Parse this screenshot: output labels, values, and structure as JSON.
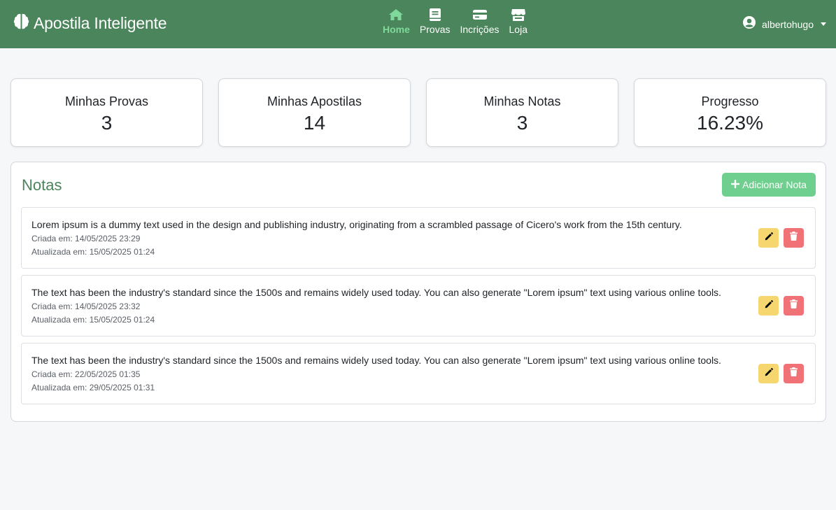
{
  "navbar": {
    "brand": "Apostila Inteligente",
    "items": [
      {
        "label": "Home",
        "icon": "home-icon",
        "active": true
      },
      {
        "label": "Provas",
        "icon": "book-icon",
        "active": false
      },
      {
        "label": "Incrições",
        "icon": "card-icon",
        "active": false
      },
      {
        "label": "Loja",
        "icon": "store-icon",
        "active": false
      }
    ],
    "user": "albertohugo"
  },
  "stats": [
    {
      "title": "Minhas Provas",
      "value": "3"
    },
    {
      "title": "Minhas Apostilas",
      "value": "14"
    },
    {
      "title": "Minhas Notas",
      "value": "3"
    },
    {
      "title": "Progresso",
      "value": "16.23%"
    }
  ],
  "notes": {
    "title": "Notas",
    "add_label": "Adicionar Nota",
    "items": [
      {
        "text": "Lorem ipsum is a dummy text used in the design and publishing industry, originating from a scrambled passage of Cicero's work from the 15th century.",
        "created": "Criada em: 14/05/2025 23:29",
        "updated": "Atualizada em: 15/05/2025 01:24"
      },
      {
        "text": "The text has been the industry's standard since the 1500s and remains widely used today. You can also generate \"Lorem ipsum\" text using various online tools.",
        "created": "Criada em: 14/05/2025 23:32",
        "updated": "Atualizada em: 15/05/2025 01:24"
      },
      {
        "text": "The text has been the industry's standard since the 1500s and remains widely used today. You can also generate \"Lorem ipsum\" text using various online tools.",
        "created": "Criada em: 22/05/2025 01:35",
        "updated": "Atualizada em: 29/05/2025 01:31"
      }
    ]
  },
  "colors": {
    "navbar": "#4b855b",
    "active_nav": "#7fd99a",
    "add_button": "#6fcf8e",
    "edit_button": "#f6d66e",
    "delete_button": "#f07176"
  }
}
